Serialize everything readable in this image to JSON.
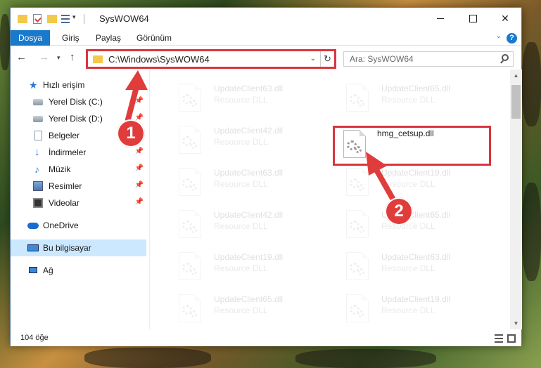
{
  "window": {
    "title": "SysWOW64"
  },
  "ribbon": {
    "tabs": [
      "Dosya",
      "Giriş",
      "Paylaş",
      "Görünüm"
    ]
  },
  "address": {
    "path": "C:\\Windows\\SysWOW64"
  },
  "search": {
    "placeholder": "Ara: SysWOW64"
  },
  "sidebar": {
    "items": [
      {
        "label": "Hızlı erişim",
        "icon": "star-icon"
      },
      {
        "label": "Yerel Disk (C:)",
        "icon": "disk-icon"
      },
      {
        "label": "Yerel Disk (D:)",
        "icon": "disk-icon"
      },
      {
        "label": "Belgeler",
        "icon": "documents-icon"
      },
      {
        "label": "İndirmeler",
        "icon": "download-icon"
      },
      {
        "label": "Müzik",
        "icon": "music-icon"
      },
      {
        "label": "Resimler",
        "icon": "pictures-icon"
      },
      {
        "label": "Videolar",
        "icon": "videos-icon"
      },
      {
        "label": "OneDrive",
        "icon": "cloud-icon"
      },
      {
        "label": "Bu bilgisayar",
        "icon": "computer-icon"
      },
      {
        "label": "Ağ",
        "icon": "network-icon"
      }
    ]
  },
  "files": {
    "left": [
      {
        "name": "UpdateClient63.dll",
        "type": "Resource DLL"
      },
      {
        "name": "UpdateClient42.dll",
        "type": "Resource DLL"
      },
      {
        "name": "UpdateClient63.dll",
        "type": "Resource DLL"
      },
      {
        "name": "UpdateClient42.dll",
        "type": "Resource DLL"
      },
      {
        "name": "UpdateClient19.dll",
        "type": "Resource DLL"
      },
      {
        "name": "UpdateClient65.dll",
        "type": "Resource DLL"
      }
    ],
    "right": [
      {
        "name": "UpdateClient65.dll",
        "type": "Resource DLL"
      },
      {
        "name": "hmg_cetsup.dll",
        "type": ""
      },
      {
        "name": "UpdateClient19.dll",
        "type": "Resource DLL"
      },
      {
        "name": "UpdateClient65.dll",
        "type": "Resource DLL"
      },
      {
        "name": "UpdateClient63.dll",
        "type": "Resource DLL"
      },
      {
        "name": "UpdateClient19.dll",
        "type": "Resource DLL"
      }
    ]
  },
  "status": {
    "count": "104 öğe"
  },
  "callouts": {
    "one": "1",
    "two": "2"
  },
  "colors": {
    "accent": "#1979ca",
    "callout": "#e03c3c",
    "selection": "#cce8ff"
  }
}
